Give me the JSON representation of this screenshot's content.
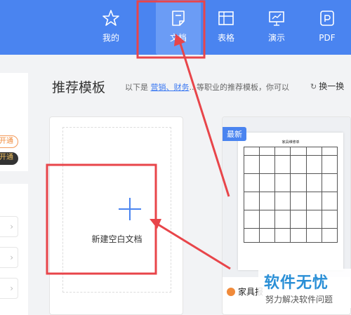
{
  "nav": {
    "items": [
      {
        "label": "我的",
        "icon": "star-icon"
      },
      {
        "label": "文档",
        "icon": "document-icon"
      },
      {
        "label": "表格",
        "icon": "table-icon"
      },
      {
        "label": "演示",
        "icon": "presentation-icon"
      },
      {
        "label": "PDF",
        "icon": "pdf-icon"
      }
    ],
    "active": "文档"
  },
  "left": {
    "badge1": "开通",
    "badge2": "开通"
  },
  "main": {
    "title": "推荐模板",
    "subtitle_prefix": "以下是",
    "subtitle_link": "营销、财务",
    "subtitle_suffix": "...等职业的推荐模板，你可以",
    "refresh_label": "换一换"
  },
  "blank": {
    "label": "新建空白文档"
  },
  "template": {
    "badge": "最新",
    "doc_title": "家具维修单",
    "name": "家具报"
  },
  "watermark": {
    "main": "软件无忧",
    "sub": "努力解决软件问题"
  },
  "colors": {
    "header": "#4a84f0",
    "accent": "#4a84f0",
    "annotation": "#e8454a"
  }
}
